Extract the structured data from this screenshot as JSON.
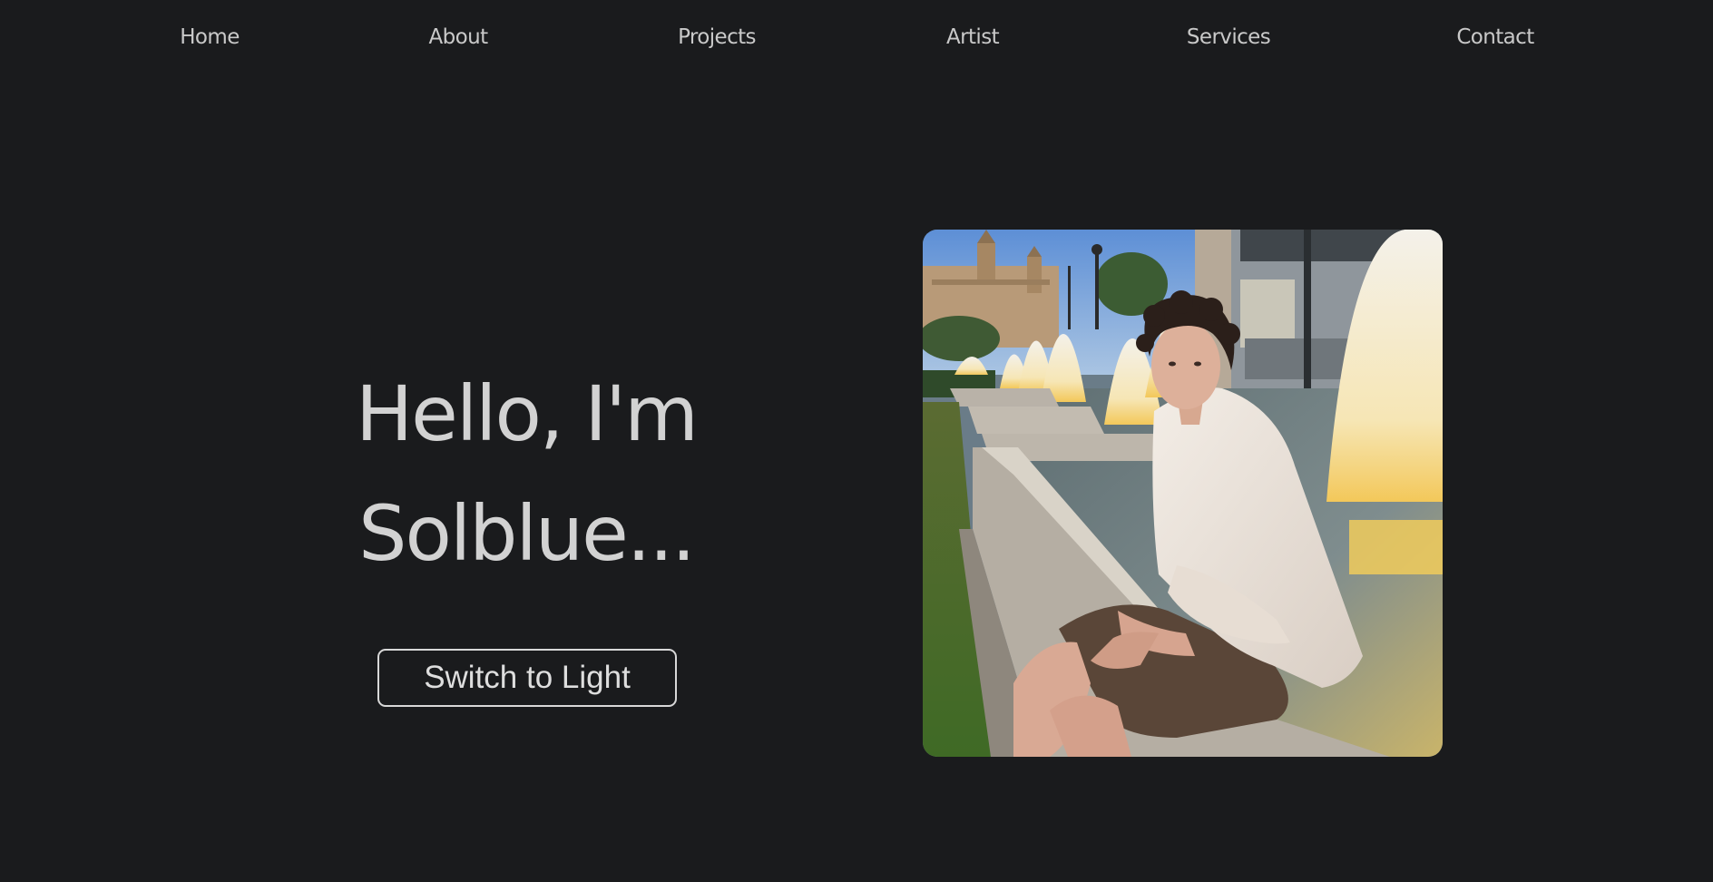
{
  "nav": {
    "items": [
      {
        "label": "Home"
      },
      {
        "label": "About"
      },
      {
        "label": "Projects"
      },
      {
        "label": "Artist"
      },
      {
        "label": "Services"
      },
      {
        "label": "Contact"
      }
    ]
  },
  "hero": {
    "title_line1": "Hello, I'm",
    "title_line2": "Solblue...",
    "switch_button_label": "Switch to Light"
  },
  "colors": {
    "background": "#1a1b1d",
    "nav_text": "#c9c9c9",
    "title_text": "#d2d2d2",
    "button_border": "#d8d8d8"
  },
  "photo": {
    "subject": "young man with curly hair in white linen shirt sitting on the edge of a fountain pool at sunset, palace building in background"
  }
}
